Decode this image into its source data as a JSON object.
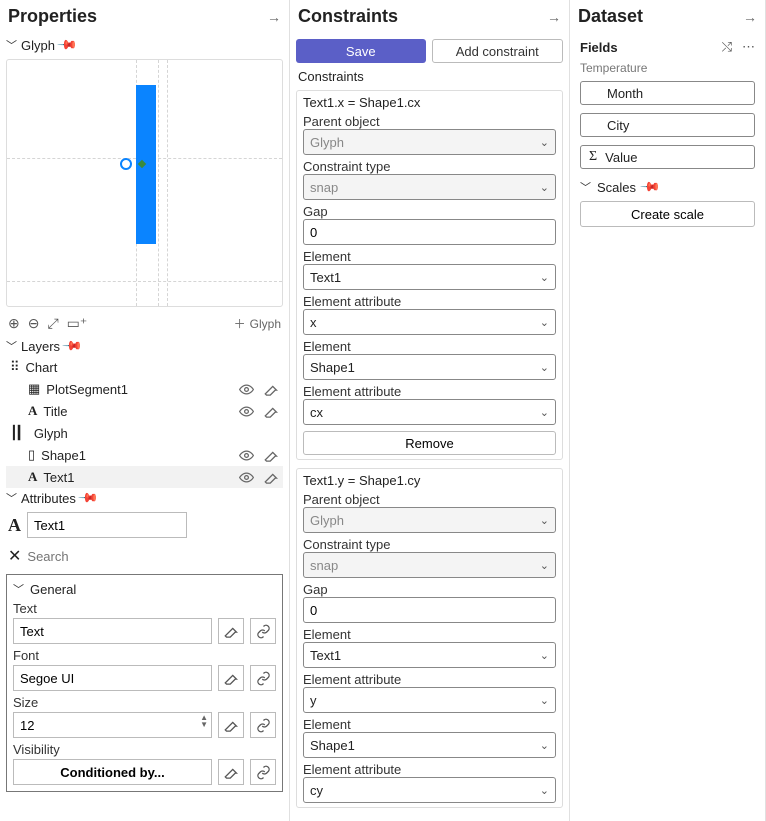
{
  "panels": {
    "properties": "Properties",
    "constraints": "Constraints",
    "dataset": "Dataset"
  },
  "properties": {
    "glyph_section": "Glyph",
    "glyph_tag": "Glyph",
    "layers_section": "Layers",
    "layers": {
      "chart": "Chart",
      "plot_segment": "PlotSegment1",
      "title": "Title",
      "glyph": "Glyph",
      "shape1": "Shape1",
      "text1": "Text1"
    },
    "attributes_section": "Attributes",
    "selected_name": "Text1",
    "search_placeholder": "Search",
    "general": {
      "heading": "General",
      "text_label": "Text",
      "text_value": "Text",
      "font_label": "Font",
      "font_value": "Segoe UI",
      "size_label": "Size",
      "size_value": "12",
      "visibility_label": "Visibility",
      "conditioned_by": "Conditioned by..."
    }
  },
  "constraints": {
    "save": "Save",
    "add": "Add constraint",
    "heading": "Constraints",
    "block1": {
      "title": "Text1.x = Shape1.cx",
      "parent_object_label": "Parent object",
      "parent_object_value": "Glyph",
      "constraint_type_label": "Constraint type",
      "constraint_type_value": "snap",
      "gap_label": "Gap",
      "gap_value": "0",
      "element_label": "Element",
      "element1_value": "Text1",
      "element_attr_label": "Element attribute",
      "attr1_value": "x",
      "element2_value": "Shape1",
      "attr2_value": "cx",
      "remove": "Remove"
    },
    "block2": {
      "title": "Text1.y = Shape1.cy",
      "parent_object_label": "Parent object",
      "parent_object_value": "Glyph",
      "constraint_type_label": "Constraint type",
      "constraint_type_value": "snap",
      "gap_label": "Gap",
      "gap_value": "0",
      "element_label": "Element",
      "element1_value": "Text1",
      "element_attr_label": "Element attribute",
      "attr1_value": "y",
      "element2_value": "Shape1",
      "attr2_value": "cy"
    }
  },
  "dataset": {
    "fields_label": "Fields",
    "group": "Temperature",
    "month": "Month",
    "city": "City",
    "value": "Value",
    "scales_label": "Scales",
    "create_scale": "Create scale"
  }
}
